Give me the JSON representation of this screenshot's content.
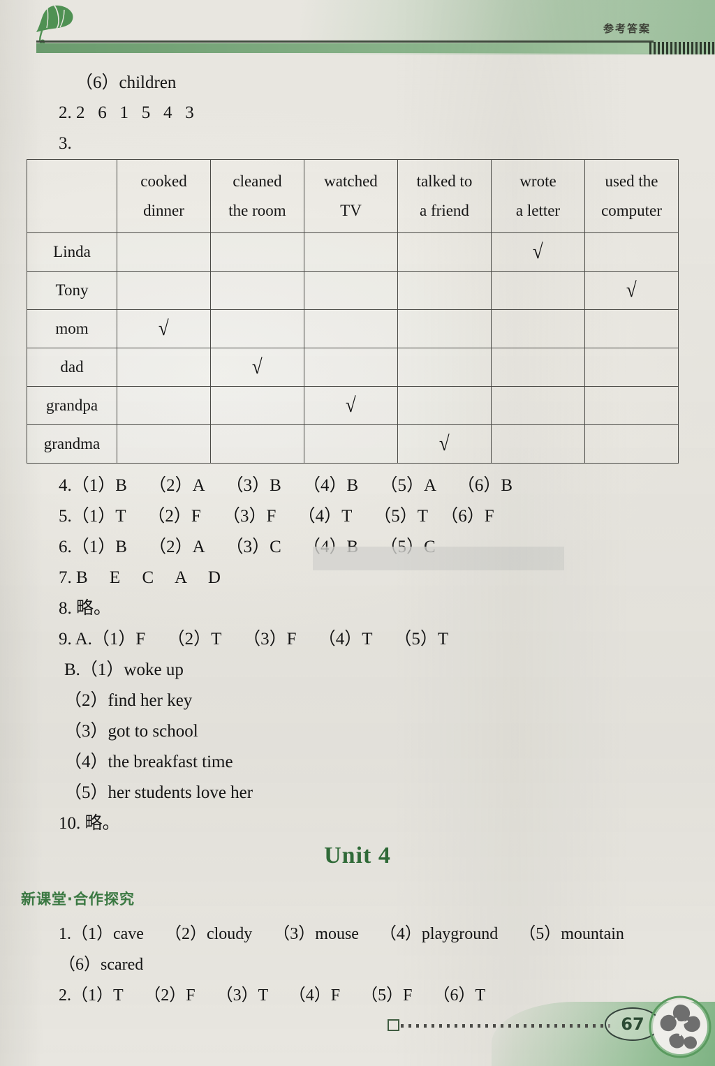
{
  "header": {
    "title_cn": "参考答案",
    "leaf_icon": "ginkgo-leaf-icon",
    "accent_green": "#6a9b6d",
    "rule_color": "#3f4a3d"
  },
  "answers_top": {
    "line_6": "（6）children",
    "line_2": "2. 2   6   1   5   4   3",
    "line_3": "3."
  },
  "table": {
    "columns": [
      {
        "line1": "",
        "line2": ""
      },
      {
        "line1": "cooked",
        "line2": "dinner"
      },
      {
        "line1": "cleaned",
        "line2": "the room"
      },
      {
        "line1": "watched",
        "line2": "TV"
      },
      {
        "line1": "talked to",
        "line2": "a friend"
      },
      {
        "line1": "wrote",
        "line2": "a letter"
      },
      {
        "line1": "used the",
        "line2": "computer"
      }
    ],
    "check_mark": "√",
    "rows": [
      {
        "label": "Linda",
        "checks": [
          false,
          false,
          false,
          false,
          true,
          false
        ]
      },
      {
        "label": "Tony",
        "checks": [
          false,
          false,
          false,
          false,
          false,
          true
        ]
      },
      {
        "label": "mom",
        "checks": [
          true,
          false,
          false,
          false,
          false,
          false
        ]
      },
      {
        "label": "dad",
        "checks": [
          false,
          true,
          false,
          false,
          false,
          false
        ]
      },
      {
        "label": "grandpa",
        "checks": [
          false,
          false,
          true,
          false,
          false,
          false
        ]
      },
      {
        "label": "grandma",
        "checks": [
          false,
          false,
          false,
          true,
          false,
          false
        ]
      }
    ]
  },
  "answers_list": {
    "item_4": "4.（1）B     （2）A     （3）B     （4）B     （5）A     （6）B",
    "item_5": "5.（1）T     （2）F     （3）F     （4）T     （5）T   （6）F",
    "item_6": "6.（1）B     （2）A     （3）C     （4）B     （5）C",
    "item_7": "7. B     E     C     A     D",
    "item_8": "8. 略。",
    "item_9_a": "9. A.（1）F     （2）T     （3）F     （4）T     （5）T",
    "item_9_b1": "B.（1）woke up",
    "item_9_b2": "（2）find her key",
    "item_9_b3": "（3）got to school",
    "item_9_b4": "（4）the breakfast time",
    "item_9_b5": "（5）her students love her",
    "item_10": "10. 略。"
  },
  "unit": {
    "title": "Unit 4",
    "section_tag": "新课堂·合作探究",
    "title_color": "#2f6b38"
  },
  "unit4_answers": {
    "item_1": "1.（1）cave     （2）cloudy     （3）mouse     （4）playground     （5）mountain",
    "item_1b": "（6）scared",
    "item_2": "2.（1）T     （2）F     （3）T     （4）F     （5）F     （6）T"
  },
  "footer": {
    "page_number": "67",
    "flower_icon": "bauhinia-flower-icon",
    "square_icon": "square-marker-icon"
  }
}
